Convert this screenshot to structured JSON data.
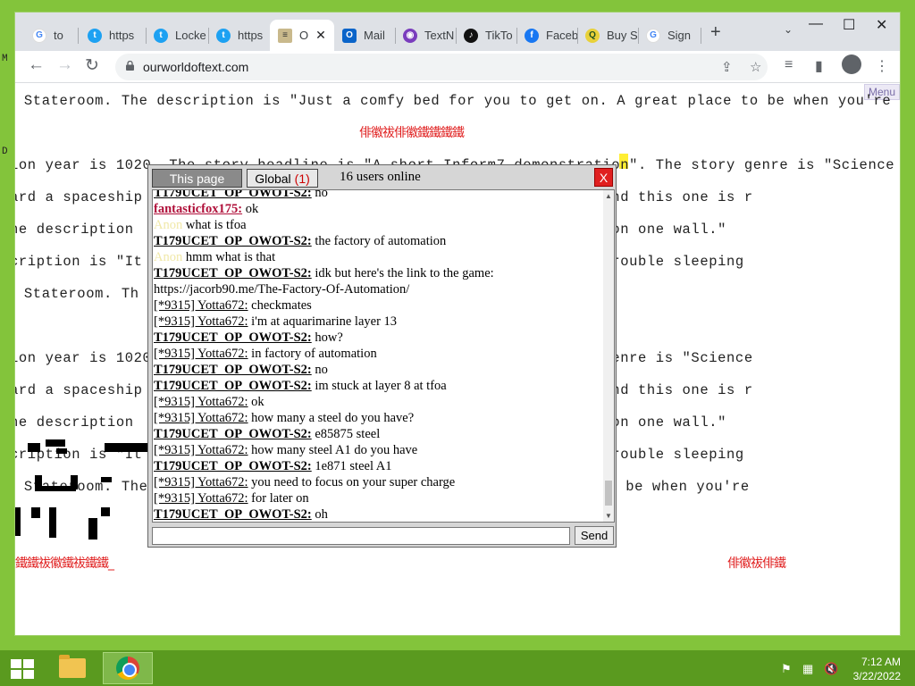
{
  "tabs": [
    {
      "label": "tony",
      "icon": "google-icon",
      "active": false
    },
    {
      "label": "https",
      "icon": "twitter-icon",
      "active": false
    },
    {
      "label": "Locke",
      "icon": "twitter-icon",
      "active": false
    },
    {
      "label": "https",
      "icon": "twitter-icon",
      "active": false
    },
    {
      "label": "O",
      "icon": "owot-icon",
      "active": true
    },
    {
      "label": "Mail",
      "icon": "outlook-icon",
      "active": false
    },
    {
      "label": "TextN",
      "icon": "textnow-icon",
      "active": false
    },
    {
      "label": "TikTo",
      "icon": "tiktok-icon",
      "active": false
    },
    {
      "label": "Faceb",
      "icon": "facebook-icon",
      "active": false
    },
    {
      "label": "Buy S",
      "icon": "buy-icon",
      "active": false
    },
    {
      "label": "Sign",
      "icon": "google-icon",
      "active": false
    }
  ],
  "new_tab": "+",
  "window": {
    "minimize": "—",
    "maximize": "☐",
    "close": "✕"
  },
  "address": {
    "url": "ourworldoftext.com"
  },
  "page": {
    "menu_label": "Menu",
    "text_lines": [
      " Stateroom. The description is \"Just a comfy bed for you to get on. A great place to be when you're",
      "ion year is 1020. The story headline is \"A short Inform7 demonstration\". The story genre is \"Science",
      "ard a spaceship                                     amped affairs, and this one is r",
      "he description                                      ere is a mirror on one wall.\"",
      "cription is \"It                                     hould you have trouble sleeping",
      " Stateroom. Th",
      "ion year is 1020                                    on\". The story genre is \"Science",
      "ard a spaceship                                     amped affairs, and this one is r",
      "he description                                      ere is a mirror on one wall.\"",
      "cription is \"It                                     hould you have trouble sleeping",
      " Stateroom. The                                     A great place to be when you're"
    ],
    "red_text": [
      "俳徽祓俳徽鐵鐵鐵鐵",
      "鐵鐵祓徽鐵祓鐵鐵_",
      "俳徽祓俳鐵"
    ]
  },
  "chat": {
    "tab_page": "This page",
    "tab_global": "Global",
    "global_count": "(1)",
    "users_online": "16 users online",
    "close": "X",
    "send": "Send",
    "input_value": "",
    "messages": [
      {
        "user": "T179UCET_OP_OWOT-S2:",
        "style": "bold",
        "text": " no"
      },
      {
        "user": "fantasticfox175:",
        "style": "red",
        "text": " ok"
      },
      {
        "user": "Anon",
        "style": "anon",
        "text": " what is tfoa"
      },
      {
        "user": "T179UCET_OP_OWOT-S2:",
        "style": "bold",
        "text": " the factory of automation"
      },
      {
        "user": "Anon",
        "style": "anon",
        "text": " hmm what is that"
      },
      {
        "user": "T179UCET_OP_OWOT-S2:",
        "style": "bold",
        "text": " idk but here's the link to the game:"
      },
      {
        "user": "",
        "style": "none",
        "text": "https://jacorb90.me/The-Factory-Of-Automation/"
      },
      {
        "user": "[*9315] Yotta672:",
        "style": "plain",
        "text": " checkmates"
      },
      {
        "user": "[*9315] Yotta672:",
        "style": "plain",
        "text": " i'm at aquarimarine layer 13"
      },
      {
        "user": "T179UCET_OP_OWOT-S2:",
        "style": "bold",
        "text": " how?"
      },
      {
        "user": "[*9315] Yotta672:",
        "style": "plain",
        "text": " in factory of automation"
      },
      {
        "user": "T179UCET_OP_OWOT-S2:",
        "style": "bold",
        "text": " no"
      },
      {
        "user": "T179UCET_OP_OWOT-S2:",
        "style": "bold",
        "text": " im stuck at layer 8 at tfoa"
      },
      {
        "user": "[*9315] Yotta672:",
        "style": "plain",
        "text": " ok"
      },
      {
        "user": "[*9315] Yotta672:",
        "style": "plain",
        "text": " how many a steel do you have?"
      },
      {
        "user": "T179UCET_OP_OWOT-S2:",
        "style": "bold",
        "text": " e85875 steel"
      },
      {
        "user": "[*9315] Yotta672:",
        "style": "plain",
        "text": " how many steel A1 do you have"
      },
      {
        "user": "T179UCET_OP_OWOT-S2:",
        "style": "bold",
        "text": " 1e871 steel A1"
      },
      {
        "user": "[*9315] Yotta672:",
        "style": "plain",
        "text": " you need to focus on your super charge"
      },
      {
        "user": "[*9315] Yotta672:",
        "style": "plain",
        "text": " for later on"
      },
      {
        "user": "T179UCET_OP_OWOT-S2:",
        "style": "bold",
        "text": " oh"
      }
    ]
  },
  "taskbar": {
    "time": "7:12 AM",
    "date": "3/22/2022",
    "tray": [
      "flag-icon",
      "network-icon",
      "volume-muted-icon"
    ]
  },
  "colors": {
    "accent_red": "#e02020",
    "desktop_green": "#83c43b",
    "taskbar_green": "#5a9a1f"
  }
}
